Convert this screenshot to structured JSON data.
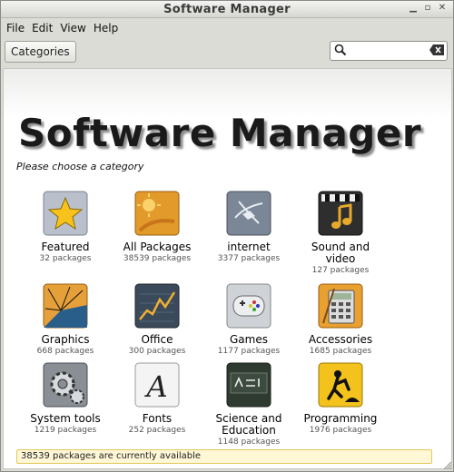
{
  "window": {
    "title": "Software Manager"
  },
  "menubar": {
    "items": [
      "File",
      "Edit",
      "View",
      "Help"
    ]
  },
  "toolbar": {
    "categories_label": "Categories",
    "search_value": ""
  },
  "main": {
    "heading": "Software Manager",
    "subtitle": "Please choose a category",
    "categories": [
      {
        "name": "Featured",
        "count": "32 packages",
        "icon": "star-icon"
      },
      {
        "name": "All Packages",
        "count": "38539 packages",
        "icon": "sun-icon"
      },
      {
        "name": "internet",
        "count": "3377 packages",
        "icon": "globe-icon"
      },
      {
        "name": "Sound and video",
        "count": "127 packages",
        "icon": "clapperboard-icon"
      },
      {
        "name": "Graphics",
        "count": "668 packages",
        "icon": "graphics-icon"
      },
      {
        "name": "Office",
        "count": "300 packages",
        "icon": "office-chart-icon"
      },
      {
        "name": "Games",
        "count": "1177 packages",
        "icon": "gamepad-icon"
      },
      {
        "name": "Accessories",
        "count": "1685 packages",
        "icon": "calculator-icon"
      },
      {
        "name": "System tools",
        "count": "1219 packages",
        "icon": "gears-icon"
      },
      {
        "name": "Fonts",
        "count": "252 packages",
        "icon": "font-icon"
      },
      {
        "name": "Science and Education",
        "count": "1148 packages",
        "icon": "formula-icon"
      },
      {
        "name": "Programming",
        "count": "1976 packages",
        "icon": "construction-icon"
      }
    ]
  },
  "status": {
    "text": "38539 packages are currently available"
  }
}
